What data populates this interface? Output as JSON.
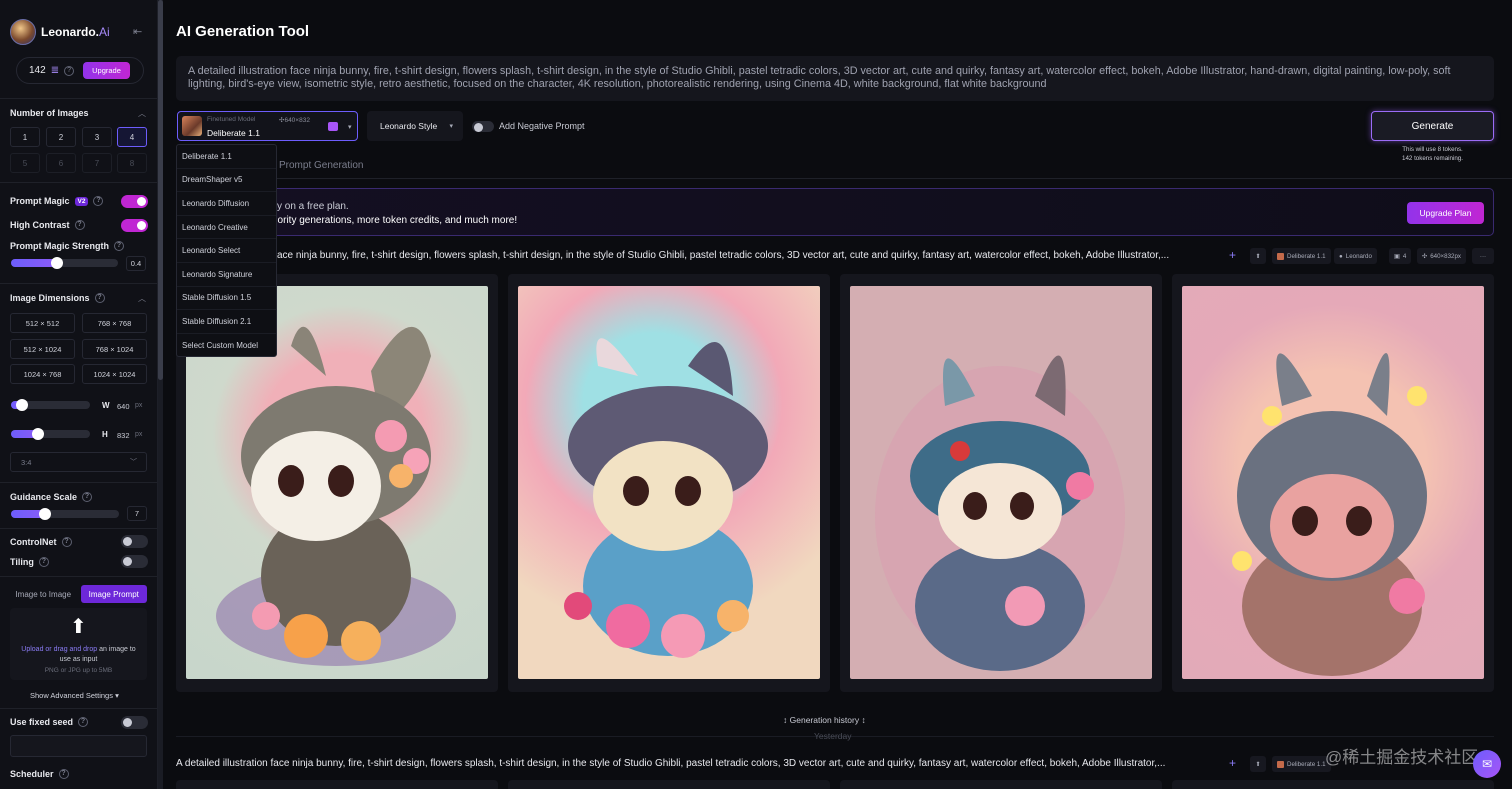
{
  "brand": {
    "name": "Leonardo.",
    "name_suffix": "Ai",
    "collapse_icon": "collapse-left-icon"
  },
  "tokens": {
    "count": "142",
    "upgrade_label": "Upgrade"
  },
  "sidebar": {
    "number_of_images": {
      "title": "Number of Images",
      "options": [
        "1",
        "2",
        "3",
        "4",
        "5",
        "6",
        "7",
        "8"
      ],
      "selected": "4"
    },
    "prompt_magic": {
      "label": "Prompt Magic",
      "badge": "V2",
      "on": true
    },
    "high_contrast": {
      "label": "High Contrast",
      "on": true
    },
    "prompt_magic_strength": {
      "label": "Prompt Magic Strength",
      "value": "0.4",
      "fraction": 0.4
    },
    "image_dimensions": {
      "title": "Image Dimensions",
      "options": [
        "512 × 512",
        "768 × 768",
        "512 × 1024",
        "768 × 1024",
        "1024 × 768",
        "1024 × 1024"
      ],
      "width_label": "W",
      "width_value": "640",
      "height_label": "H",
      "height_value": "832",
      "unit": "px",
      "aspect": "3:4"
    },
    "guidance_scale": {
      "label": "Guidance Scale",
      "value": "7"
    },
    "controlnet": {
      "label": "ControlNet",
      "on": false
    },
    "tiling": {
      "label": "Tiling",
      "on": false
    },
    "image_tabs": [
      "Image to Image",
      "Image Prompt"
    ],
    "upload": {
      "link": "Upload or drag and drop",
      "rest": " an image to use as input",
      "hint": "PNG or JPG up to 5MB"
    },
    "advanced_label": "Show Advanced Settings",
    "fixed_seed": {
      "label": "Use fixed seed",
      "on": false
    },
    "scheduler_label": "Scheduler"
  },
  "main": {
    "title": "AI Generation Tool",
    "prompt": "A detailed illustration face ninja bunny, fire, t-shirt design, flowers splash, t-shirt design, in the style of Studio Ghibli, pastel tetradic colors, 3D vector art, cute and quirky, fantasy art, watercolor effect, bokeh, Adobe Illustrator, hand-drawn, digital painting, low-poly, soft lighting, bird's-eye view, isometric style, retro aesthetic, focused on the character, 4K resolution, photorealistic rendering, using Cinema 4D, white background, flat white background",
    "model": {
      "caption": "Finetuned Model",
      "dims": "640×832",
      "name": "Deliberate 1.1"
    },
    "style": "Leonardo Style",
    "negative_prompt_label": "Add Negative Prompt",
    "generate_label": "Generate",
    "generate_note_1": "This will use 8 tokens.",
    "generate_note_2": "142 tokens remaining.",
    "tab_prompt_generation": "Prompt Generation",
    "banner": {
      "line1": "tly on a free plan.",
      "line2": "riority generations, more token credits, and much more!",
      "button": "Upgrade Plan"
    },
    "generation": {
      "prompt_truncated": "A detailed illustration face ninja bunny, fire, t-shirt design, flowers splash, t-shirt design, in the style of Studio Ghibli, pastel tetradic colors, 3D vector art, cute and quirky, fantasy art, watercolor effect, bokeh, Adobe Illustrator,...",
      "prompt_truncated_visible": "ace ninja bunny, fire, t-shirt design, flowers splash, t-shirt design, in the style of Studio Ghibli, pastel tetradic colors, 3D vector art, cute and quirky, fantasy art, watercolor effect, bokeh, Adobe Illustrator,...",
      "model_chip": "Deliberate 1.1",
      "style_chip": "Leonardo",
      "count_chip": "4",
      "dims_chip": "640×832px"
    },
    "history_label": "Generation history",
    "yesterday_label": "Yesterday",
    "dropdown_items": [
      "Deliberate 1.1",
      "DreamShaper v5",
      "Leonardo Diffusion",
      "Leonardo Creative",
      "Leonardo Select",
      "Leonardo Signature",
      "Stable Diffusion 1.5",
      "Stable Diffusion 2.1",
      "Select Custom Model"
    ]
  },
  "watermark": "@稀土掘金技术社区",
  "colors": {
    "accent": "#6d5dfc",
    "magenta": "#c026d3",
    "bg": "#0b0c10"
  }
}
